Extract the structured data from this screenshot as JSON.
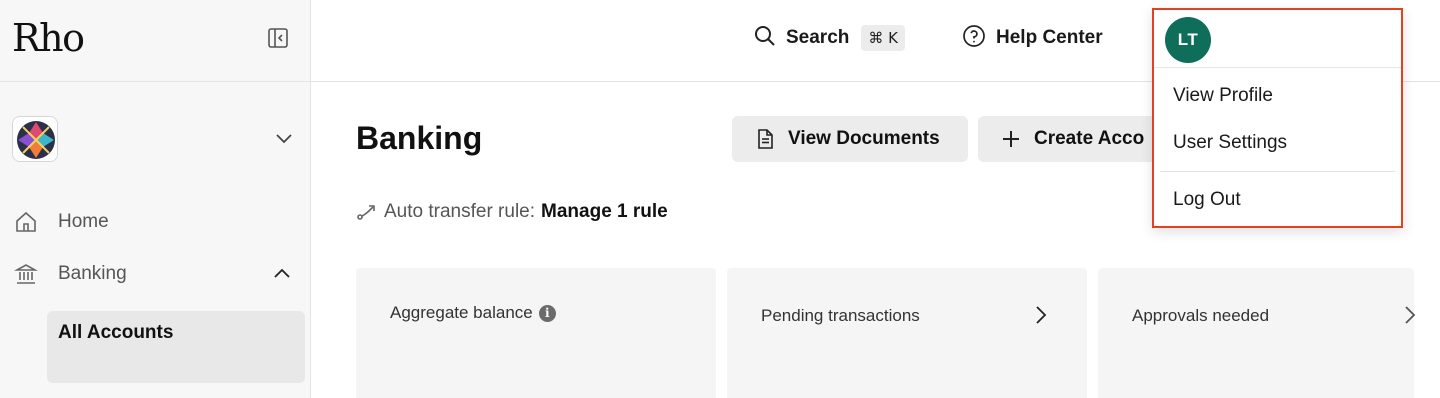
{
  "sidebar": {
    "logo": "Rho",
    "nav": [
      {
        "label": "Home",
        "icon": "home-icon"
      },
      {
        "label": "Banking",
        "icon": "bank-icon",
        "expanded": true
      }
    ],
    "sub_items": [
      {
        "label": "All Accounts",
        "active": true
      }
    ]
  },
  "topbar": {
    "search_label": "Search",
    "search_shortcut": "⌘ K",
    "help_label": "Help Center"
  },
  "main": {
    "title": "Banking",
    "buttons": {
      "view_documents": "View Documents",
      "create_account": "Create Acco"
    },
    "auto_transfer": {
      "prefix": "Auto transfer rule:",
      "link": "Manage 1 rule"
    },
    "cards": [
      {
        "title": "Aggregate balance",
        "info": "i"
      },
      {
        "title": "Pending transactions"
      },
      {
        "title": "Approvals needed"
      }
    ]
  },
  "user_menu": {
    "initials": "LT",
    "items": [
      "View Profile",
      "User Settings",
      "Log Out"
    ],
    "avatar_color": "#0f6e5a",
    "highlight_color": "#e5401f"
  }
}
